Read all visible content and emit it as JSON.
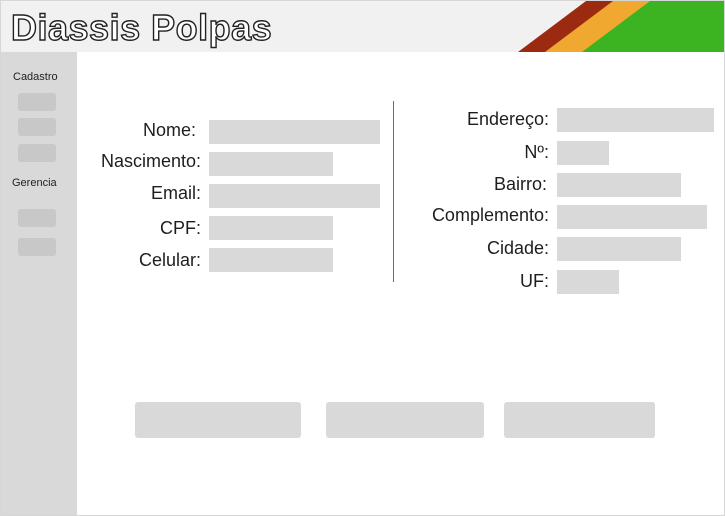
{
  "header": {
    "title": "Diassis Polpas",
    "stripe_colors": [
      "#9c2a10",
      "#f0a830",
      "#3cb421"
    ]
  },
  "sidebar": {
    "sections": [
      {
        "heading": "Cadastro",
        "item_count": 3
      },
      {
        "heading": "Gerencia",
        "item_count": 2
      }
    ]
  },
  "form": {
    "left": [
      {
        "label": "Nome:",
        "value": "",
        "placeholder": ""
      },
      {
        "label": "Nascimento:",
        "value": "",
        "placeholder": ""
      },
      {
        "label": "Email:",
        "value": "",
        "placeholder": ""
      },
      {
        "label": "CPF:",
        "value": "",
        "placeholder": ""
      },
      {
        "label": "Celular:",
        "value": "",
        "placeholder": ""
      }
    ],
    "right": [
      {
        "label": "Endereço:",
        "value": "",
        "placeholder": ""
      },
      {
        "label": "Nº:",
        "value": "",
        "placeholder": ""
      },
      {
        "label": "Bairro:",
        "value": "",
        "placeholder": ""
      },
      {
        "label": "Complemento:",
        "value": "",
        "placeholder": ""
      },
      {
        "label": "Cidade:",
        "value": "",
        "placeholder": ""
      },
      {
        "label": "UF:",
        "value": "",
        "placeholder": ""
      }
    ]
  },
  "actions": {
    "buttons": [
      {
        "label": ""
      },
      {
        "label": ""
      },
      {
        "label": ""
      }
    ]
  }
}
